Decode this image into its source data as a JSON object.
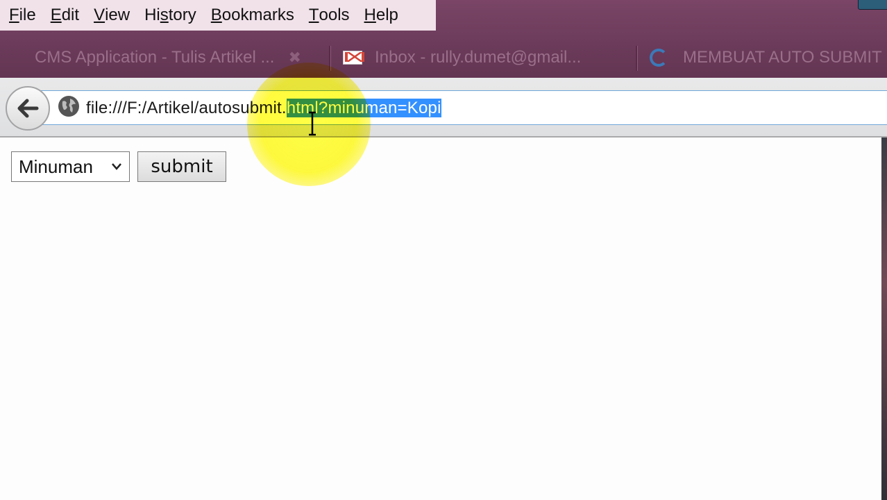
{
  "menubar": {
    "items": [
      {
        "accel": "F",
        "rest": "ile"
      },
      {
        "accel": "E",
        "rest": "dit"
      },
      {
        "accel": "V",
        "rest": "iew"
      },
      {
        "pre": "Hi",
        "accel": "s",
        "rest": "tory"
      },
      {
        "accel": "B",
        "rest": "ookmarks"
      },
      {
        "accel": "T",
        "rest": "ools"
      },
      {
        "accel": "H",
        "rest": "elp"
      }
    ]
  },
  "tabs": [
    {
      "title": "CMS Application - Tulis Artikel ...",
      "close_glyph": "✖"
    },
    {
      "title": "Inbox - rully.dumet@gmail...",
      "icon": "gmail-icon"
    },
    {
      "title": "MEMBUAT AUTO SUBMIT",
      "icon": "swirl-icon"
    }
  ],
  "navbar": {
    "url_plain": "file:///F:/Artikel/autosubmit.",
    "url_selected": "html?minuman=Kopi"
  },
  "page": {
    "select_value": "Minuman",
    "submit_label": "submit"
  },
  "colors": {
    "chrome": "#6b3a5a",
    "menubar": "#f1e2ea",
    "selection": "#3390ff",
    "highlight": "#ffff3c"
  }
}
